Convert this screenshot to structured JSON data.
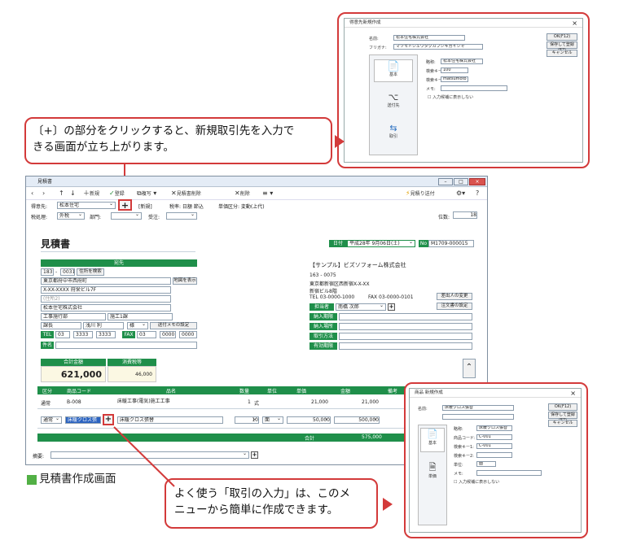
{
  "callout_top": {
    "line1": "〔+〕の部分をクリックすると、新規取引先を入力で",
    "line2": "きる画面が立ち上がります。"
  },
  "callout_bottom": {
    "line1": "よく使う「取引の入力」は、このメ",
    "line2": "ニューから簡単に作成できます。"
  },
  "screen_caption": "見積書作成画面",
  "dialog_top": {
    "title": "得意先新規作成",
    "name_label": "名前:",
    "name_value": "松本住宅株式会社",
    "kana_label": "フリガナ:",
    "kana_value": "マツモトジュウタクカブシキガイシャ",
    "f1_label": "略称:",
    "f1_value": "松本住宅株式会社",
    "f2_label": "検索キー1:",
    "f2_value": "100",
    "f3_label": "検索キー2:",
    "f3_value": "matsumoto",
    "f4_label": "メモ:",
    "check_label": "入力候補に表示しない",
    "side_basic": "基本",
    "side_dest": "送付先",
    "side_trade": "取引",
    "ok": "OK(F12)",
    "save_new": "保存して登録(F7)",
    "cancel": "キャンセル"
  },
  "dialog_bottom": {
    "title": "商品 新規作成",
    "name_label": "名前:",
    "name_value": "床暖クロス張替",
    "f1_label": "略称:",
    "f1_value": "床暖クロス張替",
    "f2_label": "商品コード:",
    "f2_value": "C-001",
    "f3_label": "検索キー1:",
    "f3_value": "C-001",
    "f4_label": "検索キー2:",
    "f5_label": "単位:",
    "f5_value": "面",
    "f6_label": "メモ:",
    "check_label": "入力候補に表示しない",
    "side_basic": "基本",
    "side_unit": "単価",
    "ok": "OK(F12)",
    "save_new": "保存して登録(F7)",
    "cancel": "キャンセル"
  },
  "main": {
    "title": "見積書",
    "toolbar": {
      "new": "新規",
      "register": "登録",
      "copy": "複写",
      "delete_reg": "見積書削除",
      "delete": "削除",
      "menu": "≡",
      "send": "見積り送付"
    },
    "customer_label": "得意先:",
    "customer_value": "松本住宅",
    "customer_badge": "[新規]",
    "tax_label": "税率: 日額 節込",
    "unit_label": "単価区分: 変動(上代)",
    "tax_type_label": "税処理:",
    "tax_type_value": "外税",
    "dept_label": "部門:",
    "status_label": "受注:",
    "page_label": "位数:",
    "page_value": "18",
    "doc_title": "見積書",
    "date_label": "日付",
    "date_value": "平成28年 9月06日(土)",
    "no_label": "No",
    "no_value": "M1709-000015",
    "addressee_hdr": "宛先",
    "zip1": "183",
    "zip2": "0031",
    "zip_btn": "住所を検索",
    "addr1": "東京都府中市西府町",
    "map_btn": "地図を表示",
    "addr2": "X-XX-XXXX 府栄ビル7F",
    "addr3": "(住所2)",
    "company": "松本住宅株式会社",
    "dept": "工事施行部",
    "section": "施工1課",
    "position": "課長",
    "person": "浅川 利",
    "honor": "様",
    "memo_btn": "送付メモの設定",
    "tel_label": "TEL",
    "tel1": "03",
    "tel2": "3333",
    "tel3": "3333",
    "fax_label": "FAX",
    "fax1": "03",
    "fax2": "0000",
    "fax3": "0000",
    "subject_label": "件名",
    "own_company": "【サンプル】ビズソフォーム株式会社",
    "own_zip": "163 - 0075",
    "own_addr": "東京都新宿区西新宿X-X-XX",
    "own_bldg": "新宿ビル8階",
    "own_tel": "TEL 03-0000-1000",
    "own_fax": "FAX 03-0000-0101",
    "own_change_btn": "差出人の変更",
    "own_settings_btn": "注文書の設定",
    "rep_label": "担当者",
    "rep_value": "南橋 次郎",
    "row_labels": [
      "納入期限",
      "納入場所",
      "取引方法",
      "有効期限"
    ],
    "total_label": "合計金額",
    "tax_total_label": "消費税等",
    "total_value": "621,000",
    "tax_total_value": "46,000",
    "table": {
      "headers": [
        "区分",
        "商品コード",
        "品名",
        "数量",
        "単位",
        "単価",
        "金額",
        "備考"
      ],
      "rows": [
        [
          "通常",
          "B-008",
          "床暖工事(電気)施工工事",
          "1",
          "式",
          "21,000",
          "21,000",
          ""
        ],
        [
          "通常",
          "床暖クロス張",
          "床暖クロス張替",
          "10",
          "面",
          "50,000",
          "500,000",
          ""
        ]
      ],
      "footer_label": "合計",
      "footer_value": "575,000"
    },
    "note_label": "摘要:"
  }
}
